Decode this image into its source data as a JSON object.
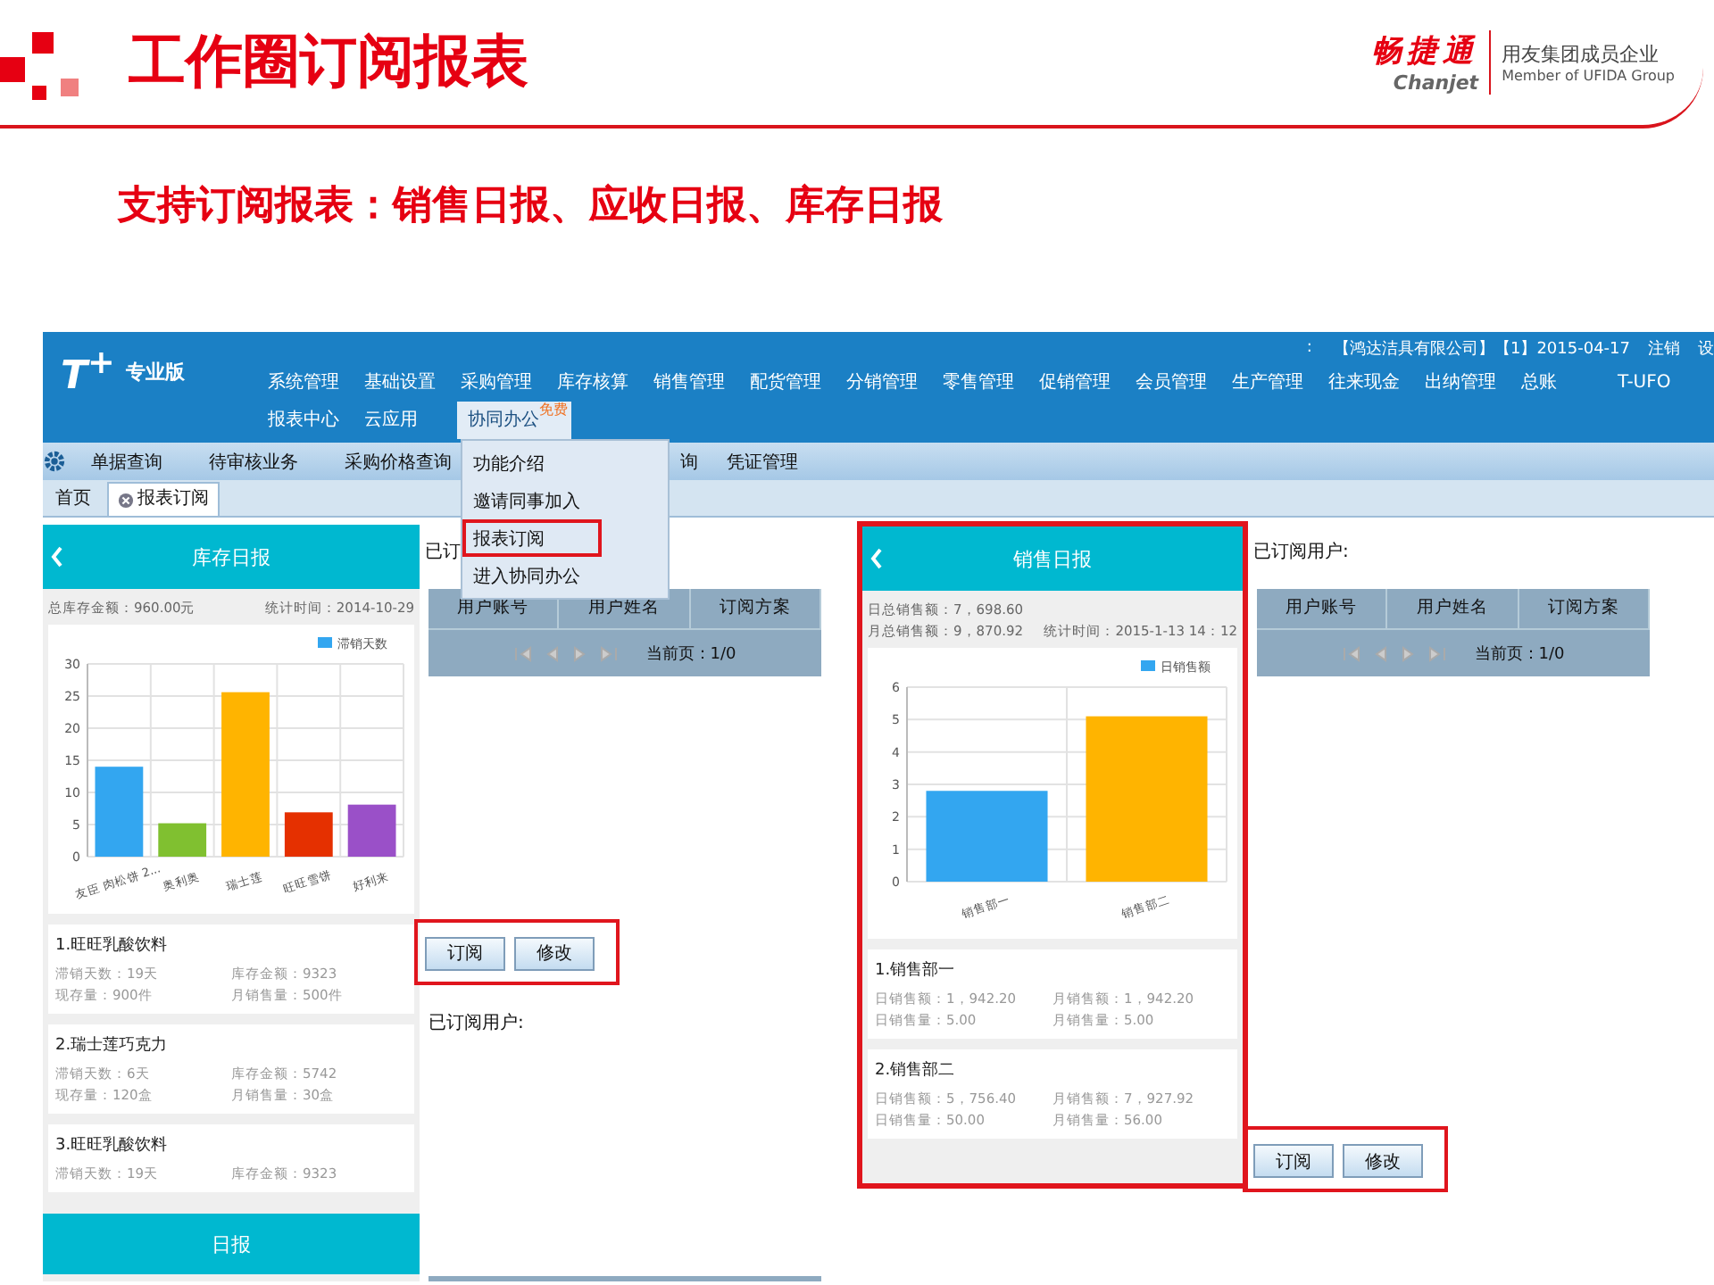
{
  "slide": {
    "title": "工作圈订阅报表",
    "logo": {
      "brand": "畅捷通",
      "brand_latin": "Chanjet",
      "group": "用友集团成员企业",
      "group_latin": "Member of UFIDA Group"
    },
    "subtitle": "支持订阅报表：销售日报、应收日报、库存日报"
  },
  "app": {
    "logo": "T$^{+}$",
    "edition": "专业版",
    "header_info": [
      ":",
      "【鸿达洁具有限公司】【1】2015-04-17",
      "注销",
      "设"
    ],
    "menu_rows": [
      [
        {
          "label": "系统管理",
          "selected": false
        },
        {
          "label": "基础设置",
          "selected": false
        },
        {
          "label": "采购管理",
          "selected": false
        },
        {
          "label": "库存核算",
          "selected": false
        },
        {
          "label": "销售管理",
          "selected": false
        },
        {
          "label": "配货管理",
          "selected": false
        },
        {
          "label": "分销管理",
          "selected": false
        },
        {
          "label": "零售管理",
          "selected": false
        },
        {
          "label": "促销管理",
          "selected": false
        },
        {
          "label": "会员管理",
          "selected": false
        },
        {
          "label": "生产管理",
          "selected": false
        },
        {
          "label": "往来现金",
          "selected": false
        },
        {
          "label": "出纳管理",
          "selected": false
        },
        {
          "label": "总账",
          "selected": false
        },
        {
          "label": "T-UFO",
          "selected": false
        }
      ],
      [
        {
          "label": "报表中心",
          "selected": false
        },
        {
          "label": "云应用",
          "selected": false
        },
        {
          "label": "协同办公",
          "selected": true,
          "badge": "免费"
        }
      ]
    ],
    "dropdown": [
      {
        "label": "功能介绍",
        "selected": false
      },
      {
        "label": "邀请同事加入",
        "selected": false
      },
      {
        "label": "报表订阅",
        "selected": true
      },
      {
        "label": "进入协同办公",
        "selected": false
      }
    ],
    "subnav": [
      "单据查询",
      "待审核业务",
      "采购价格查询",
      "询",
      "凭证管理"
    ],
    "tabs": [
      {
        "label": "首页",
        "selected": false,
        "closable": false
      },
      {
        "label": "报表订阅",
        "selected": true,
        "closable": true
      }
    ],
    "columns": [
      {
        "kind": "report",
        "highlighted": false,
        "title": "库存日报",
        "info": [
          [
            "总库存金额：960.00元",
            "统计时间：2014-10-29"
          ]
        ],
        "chart_data": {
          "type": "bar",
          "categories": [
            "友臣 肉松饼 2...",
            "奥利奥",
            "瑞士莲",
            "旺旺雪饼",
            "好利来"
          ],
          "series": [
            {
              "name": "滞销天数",
              "color": "#33a6f0",
              "colors": [
                "#33a6f0",
                "#80c030",
                "#ffb400",
                "#e53000",
                "#9a50c8"
              ],
              "values": [
                14,
                5.2,
                25.6,
                6.9,
                8.1
              ]
            }
          ],
          "grid": true,
          "ylim": [
            0,
            30
          ],
          "yticks": [
            0,
            5,
            10,
            15,
            20,
            25,
            30
          ]
        },
        "items": [
          {
            "title": "1.旺旺乳酸饮料",
            "fields": [
              "滞销天数：19天",
              "库存金额：9323",
              "现存量：900件",
              "月销售量：500件"
            ]
          },
          {
            "title": "2.瑞士莲巧克力",
            "fields": [
              "滞销天数：6天",
              "库存金额：5742",
              "现存量：120盒",
              "月销售量：30盒"
            ]
          },
          {
            "title": "3.旺旺乳酸饮料",
            "fields": [
              "滞销天数：19天",
              "库存金额：9323"
            ]
          }
        ],
        "next_header": "日报"
      },
      {
        "kind": "subscription",
        "highlighted": true,
        "label": "已订",
        "columns": [
          "用户账号",
          "用户姓名",
          "订阅方案"
        ],
        "pager": "当前页：1/0",
        "buttons": [
          "订阅",
          "修改"
        ],
        "footer_label": "已订阅用户:"
      },
      {
        "kind": "report",
        "highlighted": true,
        "title": "销售日报",
        "info": [
          [
            "日总销售额：7，698.60"
          ],
          [
            "月总销售额：9，870.92",
            "统计时间：2015-1-13  14：12"
          ]
        ],
        "chart_data": {
          "type": "bar",
          "categories": [
            "销售部一",
            "销售部二"
          ],
          "series": [
            {
              "name": "日销售额",
              "color": "#33a6f0",
              "colors": [
                "#33a6f0",
                "#ffb400"
              ],
              "values": [
                2.8,
                5.1
              ]
            }
          ],
          "grid": true,
          "ylim": [
            0,
            6
          ],
          "yticks": [
            0,
            1,
            2,
            3,
            4,
            5,
            6
          ]
        },
        "items": [
          {
            "title": "1.销售部一",
            "fields": [
              "日销售额：1，942.20",
              "月销售额：1，942.20",
              "日销售量：5.00",
              "月销售量：5.00"
            ]
          },
          {
            "title": "2.销售部二",
            "fields": [
              "日销售额：5，756.40",
              "月销售额：7，927.92",
              "日销售量：50.00",
              "月销售量：56.00"
            ]
          }
        ]
      },
      {
        "kind": "subscription",
        "highlighted": true,
        "label": "已订阅用户:",
        "columns": [
          "用户账号",
          "用户姓名",
          "订阅方案"
        ],
        "pager": "当前页：1/0",
        "buttons": [
          "订阅",
          "修改"
        ]
      }
    ]
  }
}
